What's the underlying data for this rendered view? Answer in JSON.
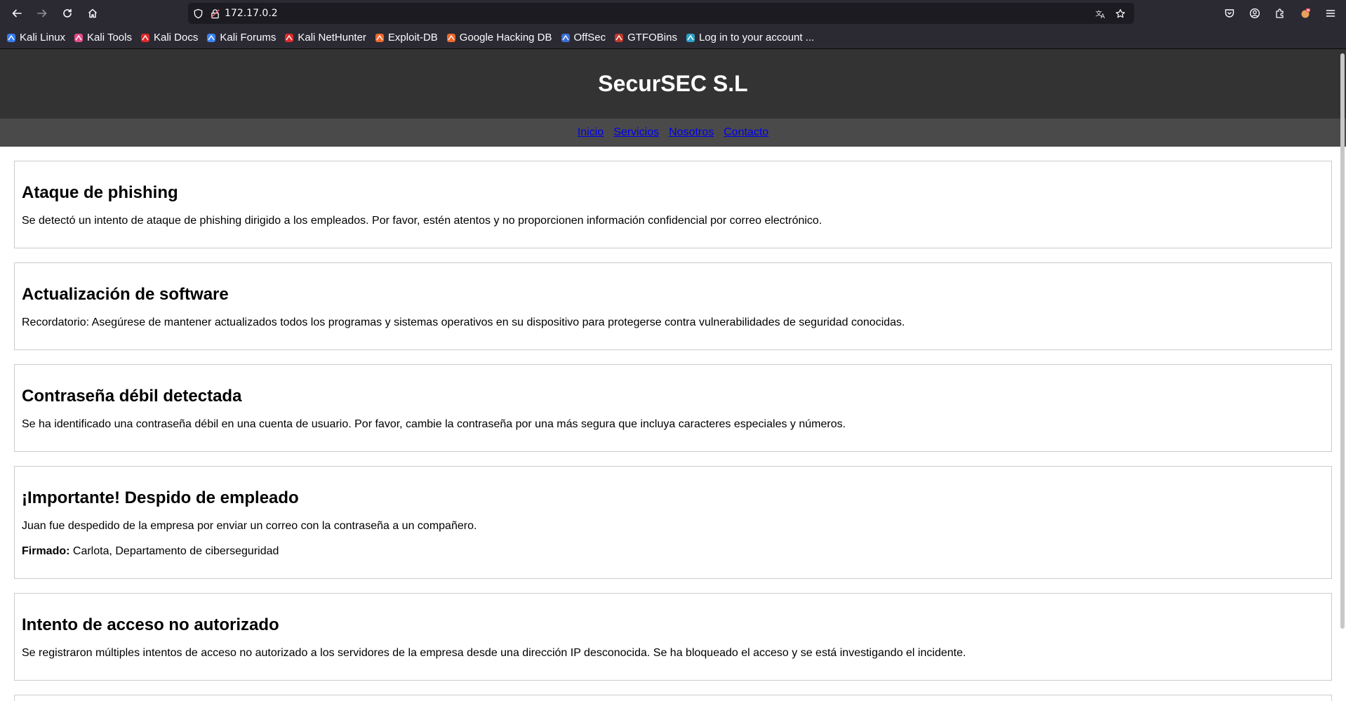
{
  "browser": {
    "url": "172.17.0.2",
    "bookmarks": [
      {
        "label": "Kali Linux",
        "icon": "kali-dragon-icon",
        "color": "#367bf0"
      },
      {
        "label": "Kali Tools",
        "icon": "kali-tools-icon",
        "color": "#e34a86"
      },
      {
        "label": "Kali Docs",
        "icon": "kali-docs-icon",
        "color": "#e0282a"
      },
      {
        "label": "Kali Forums",
        "icon": "kali-forums-icon",
        "color": "#3b82f6"
      },
      {
        "label": "Kali NetHunter",
        "icon": "kali-nethunter-icon",
        "color": "#e0282a"
      },
      {
        "label": "Exploit-DB",
        "icon": "exploit-db-icon",
        "color": "#f0672a"
      },
      {
        "label": "Google Hacking DB",
        "icon": "ghdb-icon",
        "color": "#f0672a"
      },
      {
        "label": "OffSec",
        "icon": "offsec-icon",
        "color": "#3b6fd4"
      },
      {
        "label": "GTFOBins",
        "icon": "gtfobins-icon",
        "color": "#c0392b"
      },
      {
        "label": "Log in to your account ...",
        "icon": "login-icon",
        "color": "#2aa3c9"
      }
    ]
  },
  "site": {
    "title": "SecurSEC S.L",
    "nav": [
      "Inicio",
      "Servicios",
      "Nosotros",
      "Contacto"
    ]
  },
  "posts": [
    {
      "title": "Ataque de phishing",
      "body": "Se detectó un intento de ataque de phishing dirigido a los empleados. Por favor, estén atentos y no proporcionen información confidencial por correo electrónico."
    },
    {
      "title": "Actualización de software",
      "body": "Recordatorio: Asegúrese de mantener actualizados todos los programas y sistemas operativos en su dispositivo para protegerse contra vulnerabilidades de seguridad conocidas."
    },
    {
      "title": "Contraseña débil detectada",
      "body": "Se ha identificado una contraseña débil en una cuenta de usuario. Por favor, cambie la contraseña por una más segura que incluya caracteres especiales y números."
    },
    {
      "title": "¡Importante! Despido de empleado",
      "body": "Juan fue despedido de la empresa por enviar un correo con la contraseña a un compañero.",
      "signed_label": "Firmado:",
      "signed_value": " Carlota, Departamento de ciberseguridad"
    },
    {
      "title": "Intento de acceso no autorizado",
      "body": "Se registraron múltiples intentos de acceso no autorizado a los servidores de la empresa desde una dirección IP desconocida. Se ha bloqueado el acceso y se está investigando el incidente."
    }
  ]
}
